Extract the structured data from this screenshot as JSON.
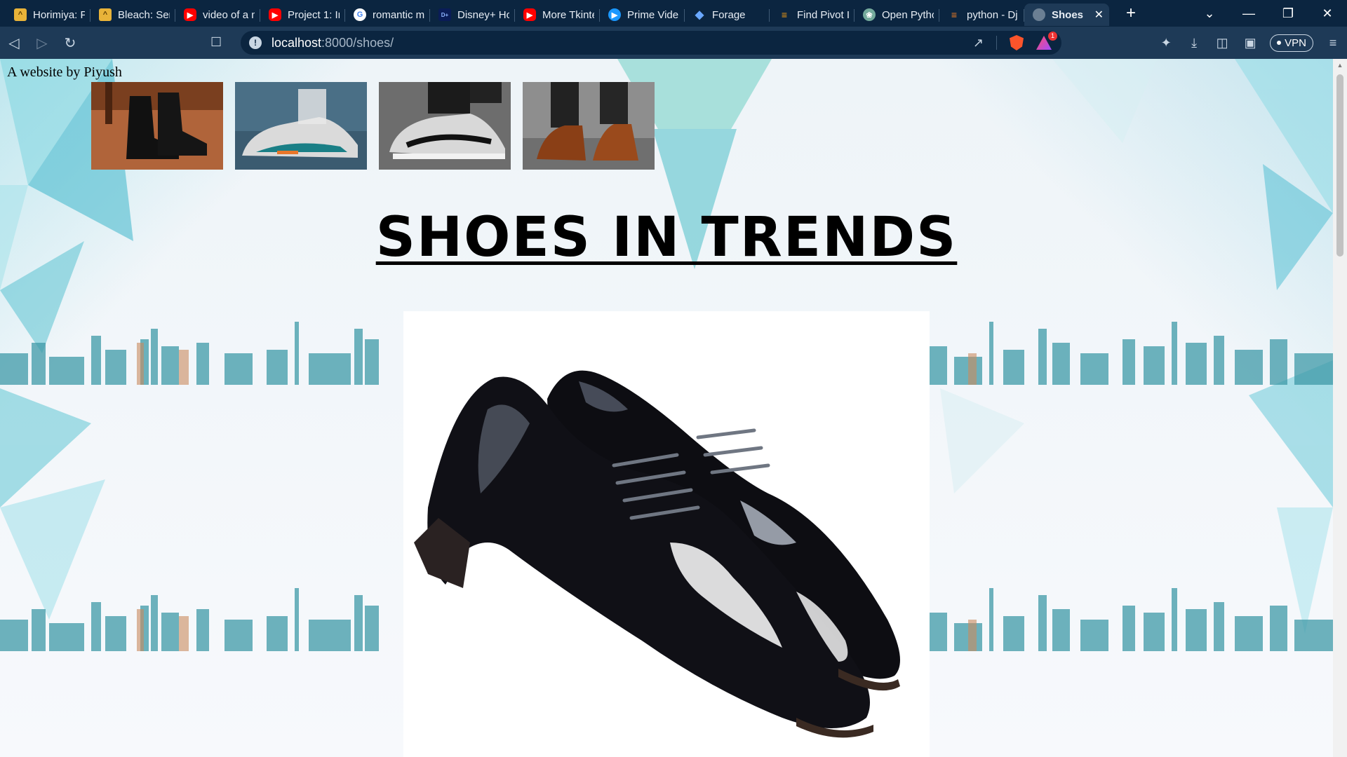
{
  "browser": {
    "tabs": [
      {
        "title": "Horimiya: P",
        "icon": "cat-icon"
      },
      {
        "title": "Bleach: Sen",
        "icon": "cat-icon"
      },
      {
        "title": "video of a n",
        "icon": "youtube-icon"
      },
      {
        "title": "Project 1: Ir",
        "icon": "youtube-icon"
      },
      {
        "title": "romantic m",
        "icon": "google-icon"
      },
      {
        "title": "Disney+ Ho",
        "icon": "disney-plus-icon"
      },
      {
        "title": "More Tkinte",
        "icon": "youtube-icon"
      },
      {
        "title": "Prime Vide",
        "icon": "prime-video-icon"
      },
      {
        "title": "Forage",
        "icon": "forage-icon"
      },
      {
        "title": "Find Pivot I",
        "icon": "find-pivot-icon"
      },
      {
        "title": "Open Pytho",
        "icon": "openai-icon"
      },
      {
        "title": "python - Dj",
        "icon": "stackoverflow-icon"
      },
      {
        "title": "Shoes",
        "icon": "globe-icon",
        "active": true
      }
    ],
    "url": {
      "host": "localhost",
      "path": ":8000/shoes/"
    },
    "vpn_label": "VPN",
    "rewards_badge": "1"
  },
  "page": {
    "credit": "A website by Piyush",
    "heading": "SHOES IN TRENDS",
    "thumbnails": [
      {
        "name": "black-ankle-boots",
        "colors": [
          "#b0643a",
          "#111111"
        ]
      },
      {
        "name": "grey-teal-sneakers",
        "colors": [
          "#4a6f86",
          "#dadada"
        ]
      },
      {
        "name": "grey-running-sneakers",
        "colors": [
          "#6d6d6d",
          "#d8d8d8"
        ]
      },
      {
        "name": "brown-oxford-shoes",
        "colors": [
          "#8e8e8e",
          "#8a3f16"
        ]
      }
    ],
    "hero_image": {
      "name": "black-patent-leather-oxfords"
    },
    "background": {
      "accent": "#53c6d8",
      "skyline": "#3f9aa8"
    }
  }
}
